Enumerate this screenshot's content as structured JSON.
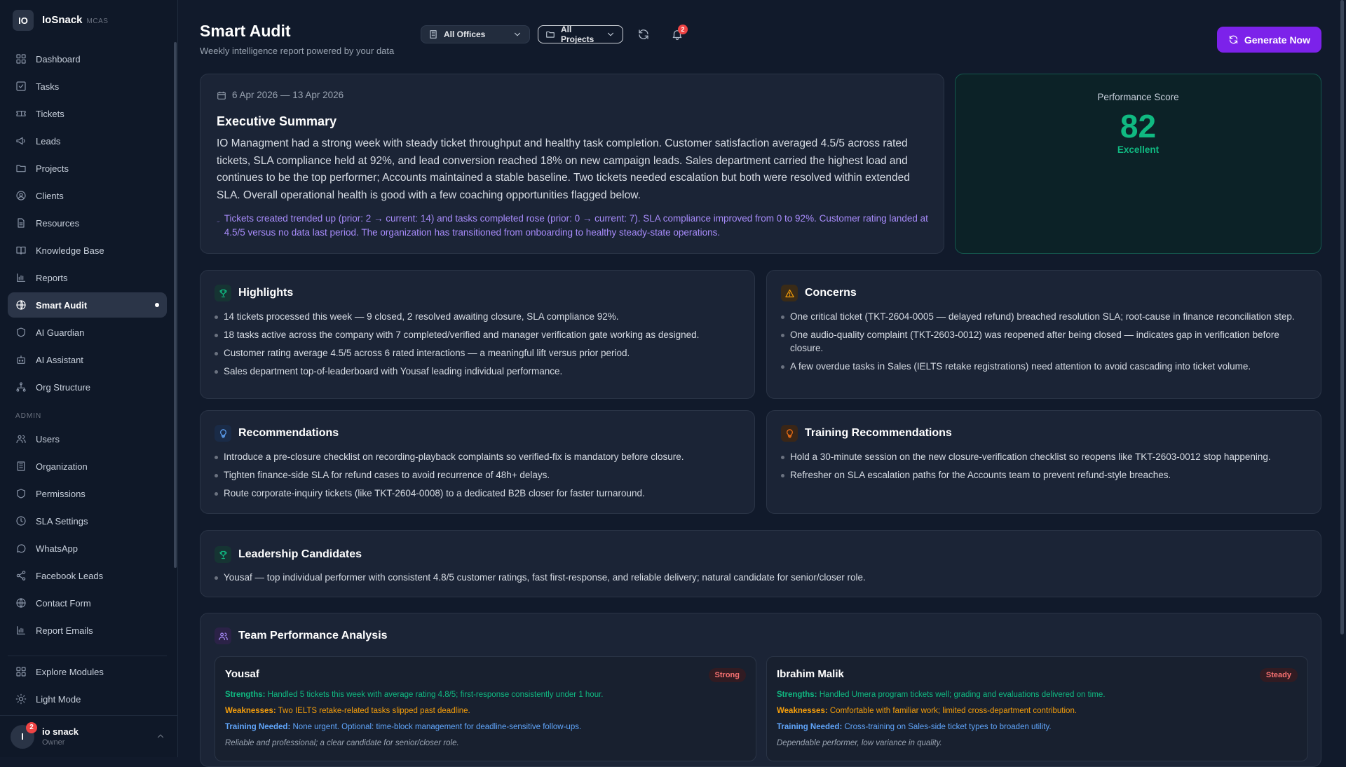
{
  "brand": {
    "logo": "IO",
    "name": "IoSnack",
    "tag": "MCAS"
  },
  "sidebar": {
    "items": [
      {
        "label": "Dashboard",
        "icon": "dashboard-icon"
      },
      {
        "label": "Tasks",
        "icon": "tasks-icon"
      },
      {
        "label": "Tickets",
        "icon": "ticket-icon"
      },
      {
        "label": "Leads",
        "icon": "megaphone-icon"
      },
      {
        "label": "Projects",
        "icon": "folder-icon"
      },
      {
        "label": "Clients",
        "icon": "user-circle-icon"
      },
      {
        "label": "Resources",
        "icon": "file-icon"
      },
      {
        "label": "Knowledge Base",
        "icon": "book-icon"
      },
      {
        "label": "Reports",
        "icon": "bar-chart-icon"
      },
      {
        "label": "Smart Audit",
        "icon": "audit-icon",
        "active": true
      },
      {
        "label": "AI Guardian",
        "icon": "shield-icon"
      },
      {
        "label": "AI Assistant",
        "icon": "robot-icon"
      },
      {
        "label": "Org Structure",
        "icon": "org-icon"
      }
    ],
    "admin_label": "ADMIN",
    "admin_items": [
      {
        "label": "Users",
        "icon": "users-icon"
      },
      {
        "label": "Organization",
        "icon": "building-icon"
      },
      {
        "label": "Permissions",
        "icon": "shield-icon"
      },
      {
        "label": "SLA Settings",
        "icon": "clock-icon"
      },
      {
        "label": "WhatsApp",
        "icon": "chat-icon"
      },
      {
        "label": "Facebook Leads",
        "icon": "share-icon"
      },
      {
        "label": "Contact Form",
        "icon": "globe-icon"
      },
      {
        "label": "Report Emails",
        "icon": "bar-chart-icon"
      }
    ],
    "bottom_items": [
      {
        "label": "Explore Modules",
        "icon": "grid-icon"
      },
      {
        "label": "Light Mode",
        "icon": "sun-icon"
      }
    ],
    "user": {
      "initial": "I",
      "name": "io snack",
      "role": "Owner",
      "badge": "2"
    }
  },
  "header": {
    "title": "Smart Audit",
    "subtitle": "Weekly intelligence report powered by your data",
    "office_select": "All Offices",
    "project_select": "All Projects",
    "notification_count": "2",
    "generate_label": "Generate Now"
  },
  "summary": {
    "date_range": "6 Apr 2026 — 13 Apr 2026",
    "title": "Executive Summary",
    "body": "IO Managment had a strong week with steady ticket throughput and healthy task completion. Customer satisfaction averaged 4.5/5 across rated tickets, SLA compliance held at 92%, and lead conversion reached 18% on new campaign leads. Sales department carried the highest load and continues to be the top performer; Accounts maintained a stable baseline. Two tickets needed escalation but both were resolved within extended SLA. Overall operational health is good with a few coaching opportunities flagged below.",
    "trend": "Tickets created trended up (prior: 2 → current: 14) and tasks completed rose (prior: 0 → current: 7). SLA compliance improved from 0 to 92%. Customer rating landed at 4.5/5 versus no data last period. The organization has transitioned from onboarding to healthy steady-state operations."
  },
  "score": {
    "label": "Performance Score",
    "value": "82",
    "rating": "Excellent",
    "color": "#10b981"
  },
  "highlights": {
    "title": "Highlights",
    "items": [
      "14 tickets processed this week — 9 closed, 2 resolved awaiting closure, SLA compliance 92%.",
      "18 tasks active across the company with 7 completed/verified and manager verification gate working as designed.",
      "Customer rating average 4.5/5 across 6 rated interactions — a meaningful lift versus prior period.",
      "Sales department top-of-leaderboard with Yousaf leading individual performance."
    ]
  },
  "concerns": {
    "title": "Concerns",
    "items": [
      "One critical ticket (TKT-2604-0005 — delayed refund) breached resolution SLA; root-cause in finance reconciliation step.",
      "One audio-quality complaint (TKT-2603-0012) was reopened after being closed — indicates gap in verification before closure.",
      "A few overdue tasks in Sales (IELTS retake registrations) need attention to avoid cascading into ticket volume."
    ]
  },
  "recommendations": {
    "title": "Recommendations",
    "items": [
      "Introduce a pre-closure checklist on recording-playback complaints so verified-fix is mandatory before closure.",
      "Tighten finance-side SLA for refund cases to avoid recurrence of 48h+ delays.",
      "Route corporate-inquiry tickets (like TKT-2604-0008) to a dedicated B2B closer for faster turnaround."
    ]
  },
  "training": {
    "title": "Training Recommendations",
    "items": [
      "Hold a 30-minute session on the new closure-verification checklist so reopens like TKT-2603-0012 stop happening.",
      "Refresher on SLA escalation paths for the Accounts team to prevent refund-style breaches."
    ]
  },
  "leadership": {
    "title": "Leadership Candidates",
    "items": [
      "Yousaf — top individual performer with consistent 4.8/5 customer ratings, fast first-response, and reliable delivery; natural candidate for senior/closer role."
    ]
  },
  "team": {
    "title": "Team Performance Analysis",
    "members": [
      {
        "name": "Yousaf",
        "status": "Strong",
        "strengths_label": "Strengths:",
        "strengths": "Handled 5 tickets this week with average rating 4.8/5; first-response consistently under 1 hour.",
        "weaknesses_label": "Weaknesses:",
        "weaknesses": "Two IELTS retake-related tasks slipped past deadline.",
        "training_label": "Training Needed:",
        "training": "None urgent. Optional: time-block management for deadline-sensitive follow-ups.",
        "note": "Reliable and professional; a clear candidate for senior/closer role."
      },
      {
        "name": "Ibrahim Malik",
        "status": "Steady",
        "strengths_label": "Strengths:",
        "strengths": "Handled Umera program tickets well; grading and evaluations delivered on time.",
        "weaknesses_label": "Weaknesses:",
        "weaknesses": "Comfortable with familiar work; limited cross-department contribution.",
        "training_label": "Training Needed:",
        "training": "Cross-training on Sales-side ticket types to broaden utility.",
        "note": "Dependable performer, low variance in quality."
      }
    ]
  },
  "colors": {
    "accent": "#7c22ea",
    "success": "#10b981",
    "warning": "#f59e0b",
    "info": "#60a5fa",
    "danger": "#f87171",
    "trend": "#a78bfa"
  }
}
